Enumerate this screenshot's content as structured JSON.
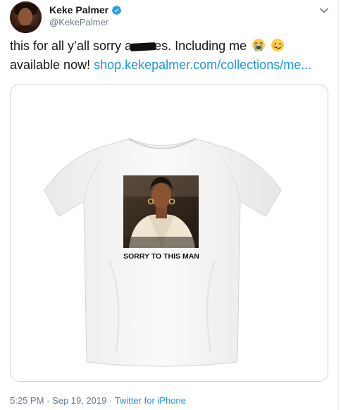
{
  "author": {
    "display_name": "Keke Palmer",
    "handle": "@KekePalmer",
    "verified": true
  },
  "tweet": {
    "line1_before": "this for all y’all sorry a",
    "line1_after": "es. Including me",
    "line1_emojis": [
      "loudly-crying-face-emoji",
      "woozy-face-emoji"
    ],
    "line2_text": " available now! ",
    "line2_link": "shop.kekepalmer.com/collections/me..."
  },
  "media": {
    "shirt_caption": "SORRY TO THIS MAN"
  },
  "footer": {
    "time": "5:25 PM",
    "date": "Sep 19, 2019",
    "separator": "·",
    "source": "Twitter for iPhone"
  },
  "colors": {
    "link": "#1b95e0",
    "secondary_text": "#657786",
    "primary_text": "#14171a",
    "border": "#ccd6dd"
  }
}
